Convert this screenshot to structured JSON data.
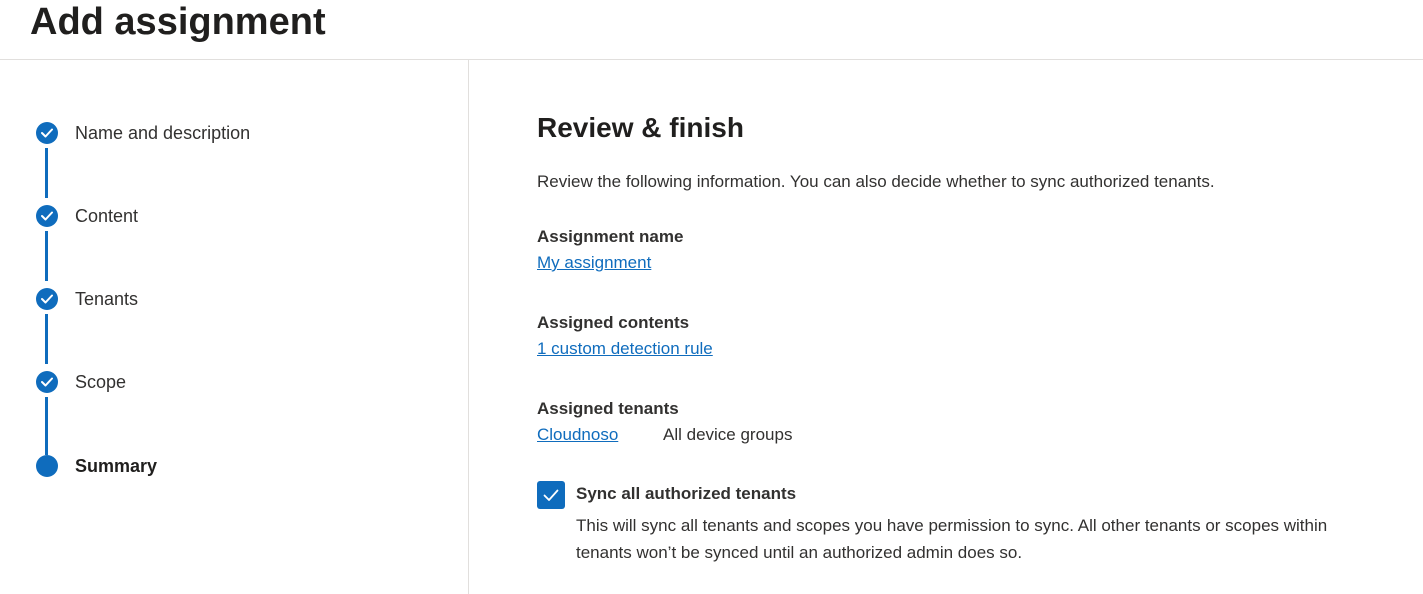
{
  "header": {
    "title": "Add assignment"
  },
  "stepper": {
    "steps": [
      {
        "label": "Name and description",
        "state": "completed",
        "icon": "checkmark-icon"
      },
      {
        "label": "Content",
        "state": "completed",
        "icon": "checkmark-icon"
      },
      {
        "label": "Tenants",
        "state": "completed",
        "icon": "checkmark-icon"
      },
      {
        "label": "Scope",
        "state": "completed",
        "icon": "checkmark-icon"
      },
      {
        "label": "Summary",
        "state": "current",
        "icon": "current-step-dot"
      }
    ]
  },
  "review": {
    "title": "Review & finish",
    "intro": "Review the following information. You can also decide whether to sync authorized tenants.",
    "assignment_name": {
      "label": "Assignment name",
      "value": "My assignment"
    },
    "assigned_contents": {
      "label": "Assigned contents",
      "value": "1 custom detection rule"
    },
    "assigned_tenants": {
      "label": "Assigned tenants",
      "tenant": "Cloudnoso",
      "scope": "All device groups"
    },
    "sync": {
      "checked": true,
      "label": "Sync all authorized tenants",
      "description": "This will sync all tenants and scopes you have permission to sync. All other tenants or scopes within tenants won’t be synced until an authorized admin does so."
    }
  },
  "colors": {
    "accent": "#0f6cbd",
    "text": "#323130",
    "divider": "#e1dfdd"
  }
}
